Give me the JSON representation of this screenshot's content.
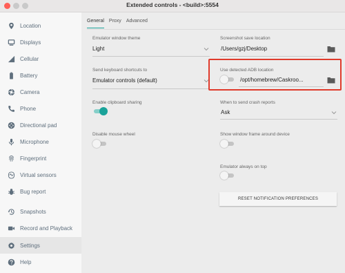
{
  "window": {
    "title": "Extended controls - <build>:5554"
  },
  "sidebar": {
    "items": [
      {
        "label": "Location",
        "icon": "location-pin-icon"
      },
      {
        "label": "Displays",
        "icon": "display-icon"
      },
      {
        "label": "Cellular",
        "icon": "cellular-signal-icon"
      },
      {
        "label": "Battery",
        "icon": "battery-icon"
      },
      {
        "label": "Camera",
        "icon": "camera-aperture-icon"
      },
      {
        "label": "Phone",
        "icon": "phone-icon"
      },
      {
        "label": "Directional pad",
        "icon": "dpad-icon"
      },
      {
        "label": "Microphone",
        "icon": "microphone-icon"
      },
      {
        "label": "Fingerprint",
        "icon": "fingerprint-icon"
      },
      {
        "label": "Virtual sensors",
        "icon": "virtual-sensors-icon"
      },
      {
        "label": "Bug report",
        "icon": "bug-icon"
      },
      {
        "label": "Snapshots",
        "icon": "snapshots-history-icon"
      },
      {
        "label": "Record and Playback",
        "icon": "record-video-icon"
      },
      {
        "label": "Settings",
        "icon": "gear-icon"
      },
      {
        "label": "Help",
        "icon": "help-icon"
      }
    ],
    "selected": "Settings"
  },
  "tabs": [
    {
      "label": "General",
      "active": true
    },
    {
      "label": "Proxy",
      "active": false
    },
    {
      "label": "Advanced",
      "active": false
    }
  ],
  "general": {
    "theme": {
      "label": "Emulator window theme",
      "value": "Light"
    },
    "screenshot": {
      "label": "Screenshot save location",
      "value": "/Users/gzj/Desktop"
    },
    "shortcuts": {
      "label": "Send keyboard shortcuts to",
      "value": "Emulator controls (default)"
    },
    "adb": {
      "label": "Use detected ADB location",
      "value": "/opt/homebrew/Caskroo...",
      "enabled": false
    },
    "clipboard": {
      "label": "Enable clipboard sharing",
      "enabled": true
    },
    "crash": {
      "label": "When to send crash reports",
      "value": "Ask"
    },
    "mousewheel": {
      "label": "Disable mouse wheel",
      "enabled": false
    },
    "frame": {
      "label": "Show window frame around device",
      "enabled": false
    },
    "ontop": {
      "label": "Emulator always on top",
      "enabled": false
    },
    "reset_label": "RESET NOTIFICATION PREFERENCES"
  },
  "colors": {
    "accent": "#1aa39a",
    "highlight": "#e03a2b",
    "sidebar_text": "#5f6f7d",
    "icon": "#5f6f7d"
  }
}
